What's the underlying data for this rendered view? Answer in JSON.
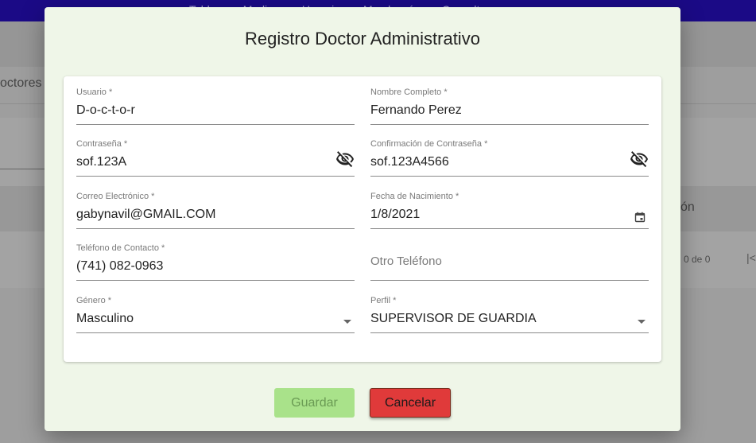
{
  "background": {
    "nav_items": "Tablero Medicos Usuarios Membresías Consulta",
    "tab_label": "octores A",
    "column_label": "ón",
    "pager_text": "0 de 0",
    "pager_nav": "|<"
  },
  "dialog": {
    "title": "Registro Doctor Administrativo",
    "fields": {
      "usuario": {
        "label": "Usuario *",
        "value": "D-o-c-t-o-r"
      },
      "nombre": {
        "label": "Nombre Completo *",
        "value": "Fernando Perez"
      },
      "contrasena": {
        "label": "Contraseña *",
        "value": "sof.123A",
        "icon": "eye-off-icon"
      },
      "confirmacion": {
        "label": "Confirmación de Contraseña *",
        "value": "sof.123A4566",
        "icon": "eye-off-icon"
      },
      "correo": {
        "label": "Correo Electrónico *",
        "value": "gabynavil@GMAIL.COM"
      },
      "fecha": {
        "label": "Fecha de Nacimiento *",
        "value": "1/8/2021",
        "icon": "calendar-icon"
      },
      "telefono": {
        "label": "Teléfono de Contacto *",
        "value": "(741) 082-0963"
      },
      "otro_telefono": {
        "placeholder": "Otro Teléfono"
      },
      "genero": {
        "label": "Género *",
        "value": "Masculino"
      },
      "perfil": {
        "label": "Perfil *",
        "value": "SUPERVISOR DE GUARDIA"
      }
    },
    "buttons": {
      "save_label": "Guardar",
      "cancel_label": "Cancelar"
    }
  },
  "colors": {
    "topbar": "#1b0a86",
    "dialog_bg": "#eff6e8",
    "save_button": "#a9e28a",
    "cancel_button": "#e03a3a"
  }
}
